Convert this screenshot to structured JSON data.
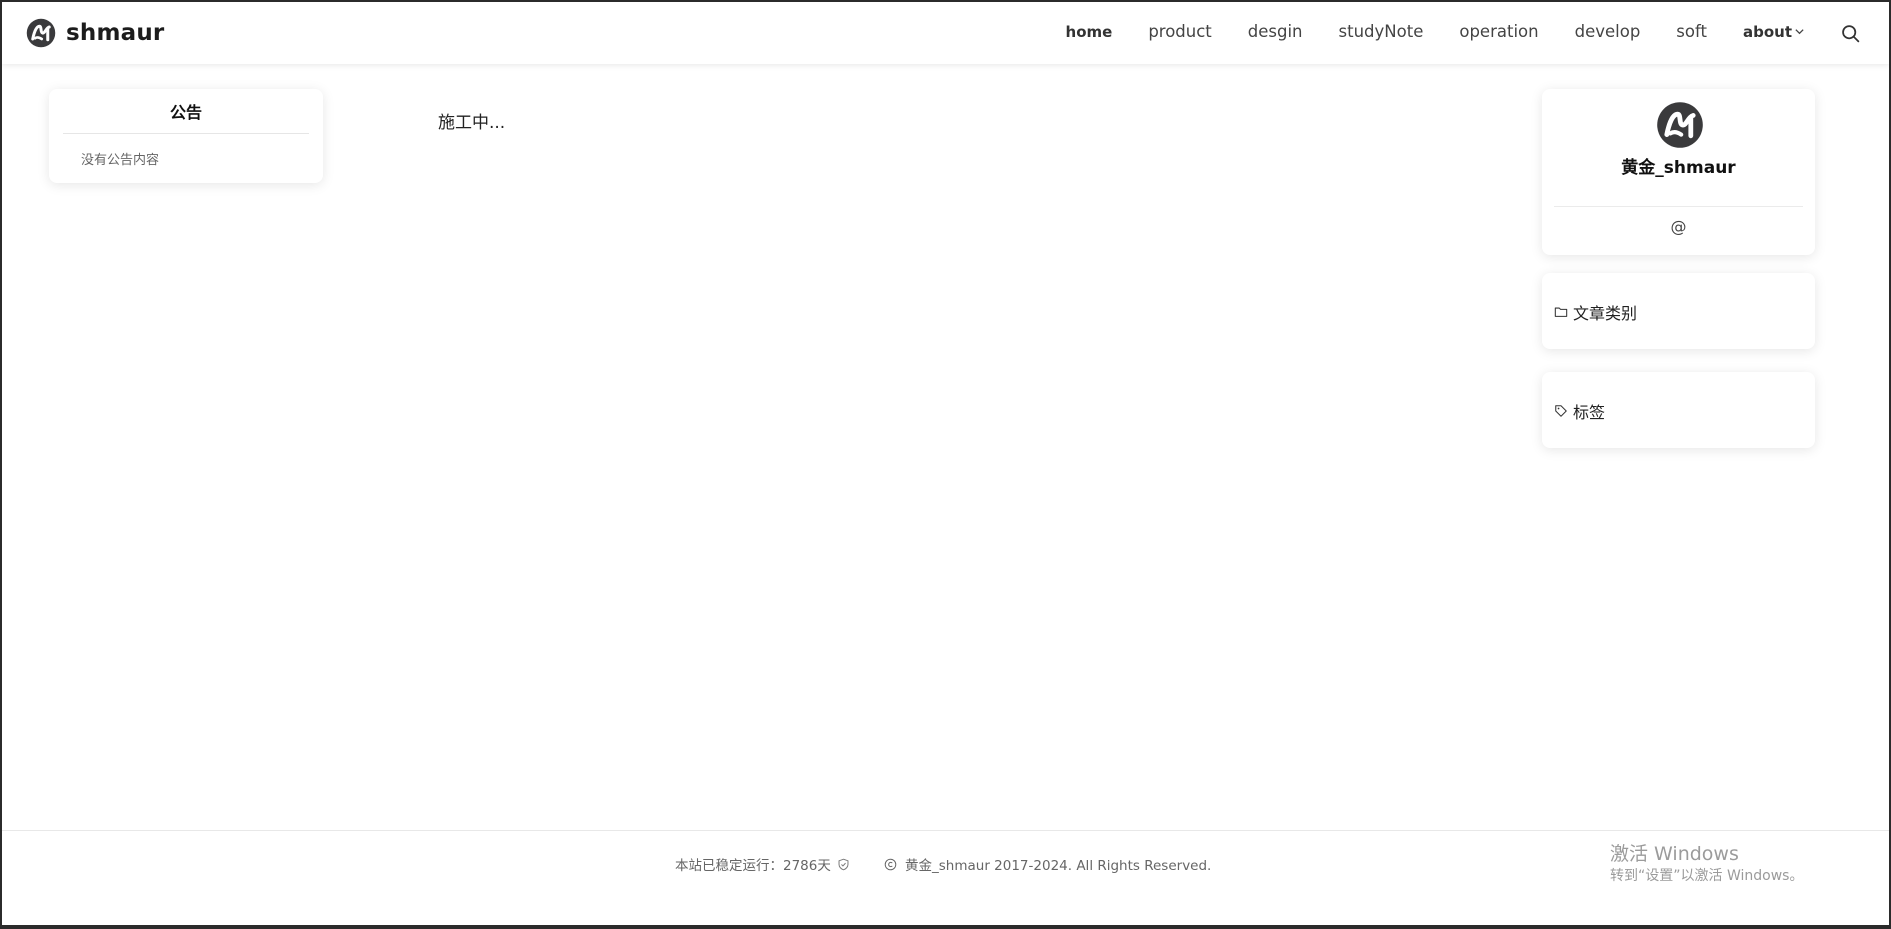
{
  "header": {
    "brand_name": "shmaur",
    "nav": {
      "home": "home",
      "product": "product",
      "desgin": "desgin",
      "studyNote": "studyNote",
      "operation": "operation",
      "develop": "develop",
      "soft": "soft",
      "about": "about"
    }
  },
  "left": {
    "notice_title": "公告",
    "notice_text": "没有公告内容"
  },
  "main": {
    "text": "施工中..."
  },
  "right": {
    "profile_name": "黄金_shmaur",
    "contact_symbol": "@",
    "categories_title": "文章类别",
    "tags_title": "标签"
  },
  "footer": {
    "runtime": "本站已稳定运行：2786天",
    "copyright": "黄金_shmaur 2017-2024. All Rights Reserved."
  },
  "watermark": {
    "title": "激活 Windows",
    "subtitle": "转到“设置”以激活 Windows。"
  },
  "colors": {
    "logo_dark": "#3a3a3c",
    "text_primary": "#111111",
    "text_muted": "#666666"
  }
}
